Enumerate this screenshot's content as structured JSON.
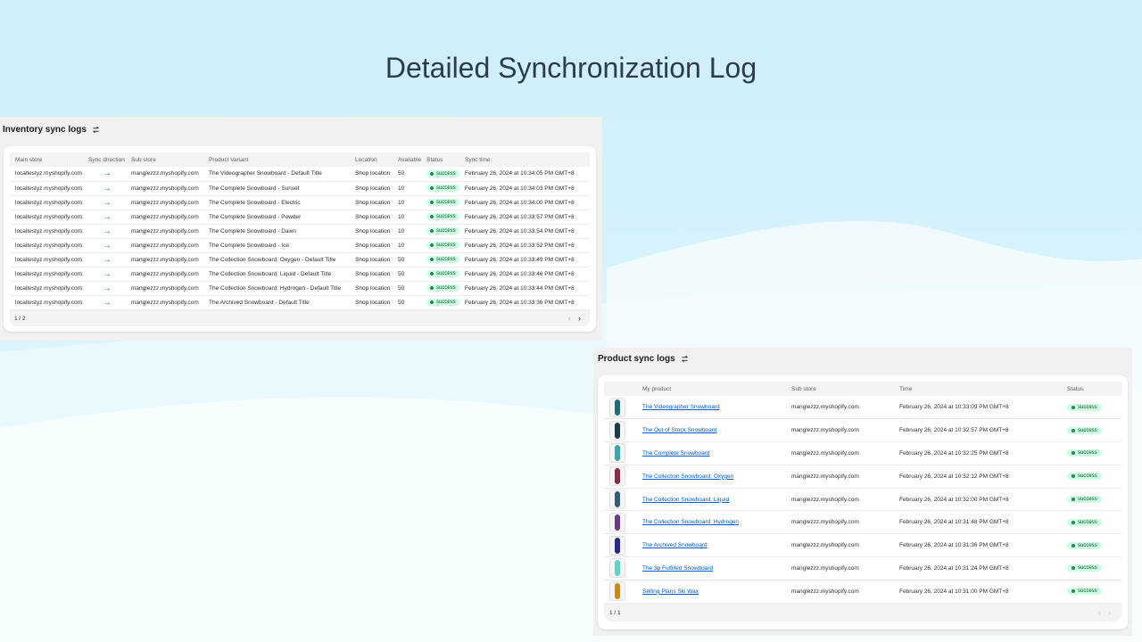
{
  "headline": "Detailed Synchronization Log",
  "inventory": {
    "title": "Inventory sync logs",
    "columns": [
      "Main store",
      "Sync direction",
      "Sub store",
      "Product Variant",
      "Location",
      "Available",
      "Status",
      "Sync time"
    ],
    "rows": [
      {
        "main": "localtestyz.myshopify.com",
        "dir": "→",
        "sub": "manglezzz.myshopify.com",
        "variant": "The Videographer Snowboard - Default Title",
        "location": "Shop location",
        "available": "50",
        "status": "success",
        "time": "February 26, 2024 at 10:34:05 PM GMT+8"
      },
      {
        "main": "localtestyz.myshopify.com",
        "dir": "→",
        "sub": "manglezzz.myshopify.com",
        "variant": "The Complete Snowboard - Sunset",
        "location": "Shop location",
        "available": "10",
        "status": "success",
        "time": "February 26, 2024 at 10:34:03 PM GMT+8"
      },
      {
        "main": "localtestyz.myshopify.com",
        "dir": "→",
        "sub": "manglezzz.myshopify.com",
        "variant": "The Complete Snowboard - Electric",
        "location": "Shop location",
        "available": "10",
        "status": "success",
        "time": "February 26, 2024 at 10:34:00 PM GMT+8"
      },
      {
        "main": "localtestyz.myshopify.com",
        "dir": "→",
        "sub": "manglezzz.myshopify.com",
        "variant": "The Complete Snowboard - Powder",
        "location": "Shop location",
        "available": "10",
        "status": "success",
        "time": "February 26, 2024 at 10:33:57 PM GMT+8"
      },
      {
        "main": "localtestyz.myshopify.com",
        "dir": "→",
        "sub": "manglezzz.myshopify.com",
        "variant": "The Complete Snowboard - Dawn",
        "location": "Shop location",
        "available": "10",
        "status": "success",
        "time": "February 26, 2024 at 10:33:54 PM GMT+8"
      },
      {
        "main": "localtestyz.myshopify.com",
        "dir": "→",
        "sub": "manglezzz.myshopify.com",
        "variant": "The Complete Snowboard - Ice",
        "location": "Shop location",
        "available": "10",
        "status": "success",
        "time": "February 26, 2024 at 10:33:52 PM GMT+8"
      },
      {
        "main": "localtestyz.myshopify.com",
        "dir": "→",
        "sub": "manglezzz.myshopify.com",
        "variant": "The Collection Snowboard: Oxygen - Default Title",
        "location": "Shop location",
        "available": "50",
        "status": "success",
        "time": "February 26, 2024 at 10:33:49 PM GMT+8"
      },
      {
        "main": "localtestyz.myshopify.com",
        "dir": "→",
        "sub": "manglezzz.myshopify.com",
        "variant": "The Collection Snowboard: Liquid - Default Title",
        "location": "Shop location",
        "available": "50",
        "status": "success",
        "time": "February 26, 2024 at 10:33:46 PM GMT+8"
      },
      {
        "main": "localtestyz.myshopify.com",
        "dir": "→",
        "sub": "manglezzz.myshopify.com",
        "variant": "The Collection Snowboard: Hydrogen - Default Title",
        "location": "Shop location",
        "available": "50",
        "status": "success",
        "time": "February 26, 2024 at 10:33:44 PM GMT+8"
      },
      {
        "main": "localtestyz.myshopify.com",
        "dir": "→",
        "sub": "manglezzz.myshopify.com",
        "variant": "The Archived Snowboard - Default Title",
        "location": "Shop location",
        "available": "50",
        "status": "success",
        "time": "February 26, 2024 at 10:33:36 PM GMT+8"
      }
    ],
    "page": "1 / 2",
    "prev": "‹",
    "next": "›"
  },
  "product": {
    "title": "Product sync logs",
    "columns": [
      "",
      "My product",
      "Sub store",
      "Time",
      "Status"
    ],
    "rows": [
      {
        "name": "The Videographer Snowboard",
        "sub": "manglezzz.myshopify.com",
        "time": "February 26, 2024 at 10:33:09 PM GMT+8",
        "status": "success",
        "color": "#1f6f7a"
      },
      {
        "name": "The Out of Stock Snowboard",
        "sub": "manglezzz.myshopify.com",
        "time": "February 26, 2024 at 10:32:57 PM GMT+8",
        "status": "success",
        "color": "#1b3b4a"
      },
      {
        "name": "The Complete Snowboard",
        "sub": "manglezzz.myshopify.com",
        "time": "February 26, 2024 at 10:32:25 PM GMT+8",
        "status": "success",
        "color": "#3aa6b0"
      },
      {
        "name": "The Collection Snowboard: Oxygen",
        "sub": "manglezzz.myshopify.com",
        "time": "February 26, 2024 at 10:32:12 PM GMT+8",
        "status": "success",
        "color": "#8b2a4a"
      },
      {
        "name": "The Collection Snowboard: Liquid",
        "sub": "manglezzz.myshopify.com",
        "time": "February 26, 2024 at 10:32:00 PM GMT+8",
        "status": "success",
        "color": "#2e5c7a"
      },
      {
        "name": "The Collection Snowboard: Hydrogen",
        "sub": "manglezzz.myshopify.com",
        "time": "February 26, 2024 at 10:31:48 PM GMT+8",
        "status": "success",
        "color": "#6a3a8a"
      },
      {
        "name": "The Archived Snowboard",
        "sub": "manglezzz.myshopify.com",
        "time": "February 26, 2024 at 10:31:36 PM GMT+8",
        "status": "success",
        "color": "#2a2a8a"
      },
      {
        "name": "The 3p Fulfilled Snowboard",
        "sub": "manglezzz.myshopify.com",
        "time": "February 26, 2024 at 10:31:24 PM GMT+8",
        "status": "success",
        "color": "#5fd3c4"
      },
      {
        "name": "Selling Plans Ski Wax",
        "sub": "manglezzz.myshopify.com",
        "time": "February 26, 2024 at 10:31:00 PM GMT+8",
        "status": "success",
        "color": "#c98a1a"
      }
    ],
    "page": "1 / 1",
    "prev": "‹",
    "next": "›"
  },
  "colors": {
    "success_bg": "#cdfee1",
    "success_text": "#0c5132",
    "link": "#005bd3",
    "heading": "#2c3b4f"
  },
  "icons": {
    "refresh": "refresh-icon",
    "arrow": "arrow-right-icon",
    "prev": "chevron-left-icon",
    "next": "chevron-right-icon"
  }
}
